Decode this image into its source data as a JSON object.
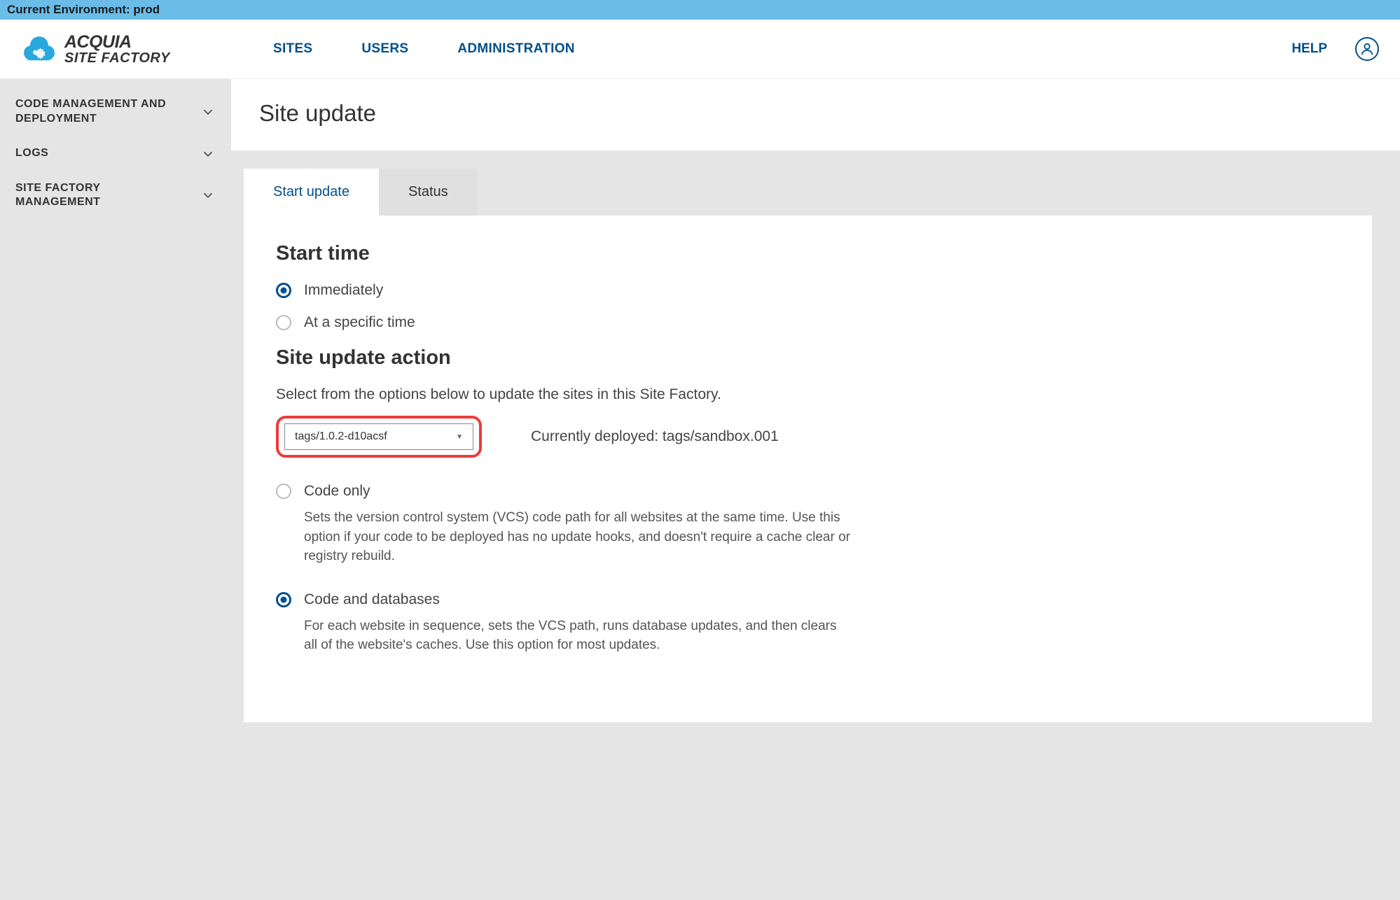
{
  "env_banner": "Current Environment: prod",
  "brand": {
    "line1": "ACQUIA",
    "line2": "SITE FACTORY"
  },
  "topnav": {
    "sites": "SITES",
    "users": "USERS",
    "admin": "ADMINISTRATION",
    "help": "HELP"
  },
  "sidebar": {
    "items": [
      {
        "label": "CODE MANAGEMENT AND DEPLOYMENT"
      },
      {
        "label": "LOGS"
      },
      {
        "label": "SITE FACTORY MANAGEMENT"
      }
    ]
  },
  "page": {
    "title": "Site update"
  },
  "tabs": {
    "start": "Start update",
    "status": "Status"
  },
  "start_time": {
    "heading": "Start time",
    "immediately": "Immediately",
    "specific": "At a specific time"
  },
  "action": {
    "heading": "Site update action",
    "instruction": "Select from the options below to update the sites in this Site Factory.",
    "select_value": "tags/1.0.2-d10acsf",
    "deployed_note": "Currently deployed: tags/sandbox.001",
    "code_only": {
      "label": "Code only",
      "desc": "Sets the version control system (VCS) code path for all websites at the same time. Use this option if your code to be deployed has no update hooks, and doesn't require a cache clear or registry rebuild."
    },
    "code_db": {
      "label": "Code and databases",
      "desc": "For each website in sequence, sets the VCS path, runs database updates, and then clears all of the website's caches. Use this option for most updates."
    }
  }
}
